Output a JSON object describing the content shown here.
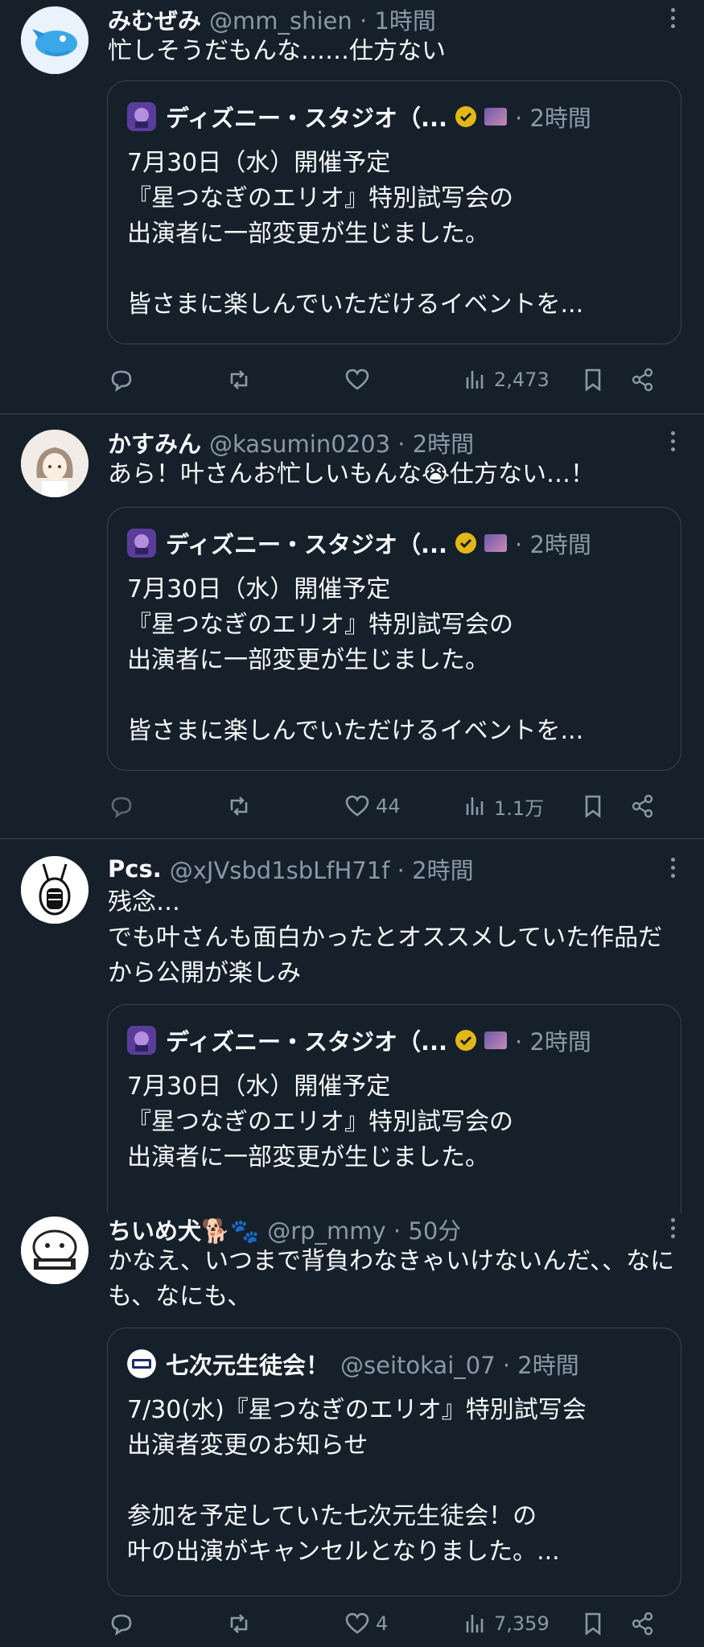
{
  "tweets": [
    {
      "name": "みむぜみ",
      "handle": "@mm_shien · 1時間",
      "text": "忙しそうだもんな……仕方ない",
      "quote": {
        "name": "ディズニー・スタジオ（...",
        "time": "· 2時間",
        "text": "7月30日（水）開催予定\n『星つなぎのエリオ』特別試写会の\n出演者に一部変更が生じました。\n\n皆さまに楽しんでいただけるイベントを..."
      },
      "likes": "",
      "views": "2,473"
    },
    {
      "name": "かすみん",
      "handle": "@kasumin0203 · 2時間",
      "text": "あら！叶さんお忙しいもんな😭仕方ない…！",
      "quote": {
        "name": "ディズニー・スタジオ（...",
        "time": "· 2時間",
        "text": "7月30日（水）開催予定\n『星つなぎのエリオ』特別試写会の\n出演者に一部変更が生じました。\n\n皆さまに楽しんでいただけるイベントを..."
      },
      "likes": "44",
      "views": "1.1万"
    },
    {
      "name": "Pcs.",
      "handle": "@xJVsbd1sbLfH71f · 2時間",
      "text": "残念…\nでも叶さんも面白かったとオススメしていた作品だから公開が楽しみ",
      "quote": {
        "name": "ディズニー・スタジオ（...",
        "time": "· 2時間",
        "text": "7月30日（水）開催予定\n『星つなぎのエリオ』特別試写会の\n出演者に一部変更が生じました。"
      }
    },
    {
      "name": "ちいめ犬🐕🐾",
      "handle": "@rp_mmy · 50分",
      "text": "かなえ、いつまで背負わなきゃいけないんだ、、なにも、なにも、",
      "quote": {
        "name": "七次元生徒会！",
        "time": "@seitokai_07 · 2時間",
        "text": "7/30(水)『星つなぎのエリオ』特別試写会\n出演者変更のお知らせ\n\n参加を予定していた七次元生徒会！の\n叶の出演がキャンセルとなりました。..."
      },
      "likes": "4",
      "views": "7,359"
    }
  ],
  "colors": {
    "background": "#15202b",
    "text": "#f7f9f9",
    "secondary": "#8b98a5",
    "border": "#38444d",
    "verified": "#e2b719"
  }
}
